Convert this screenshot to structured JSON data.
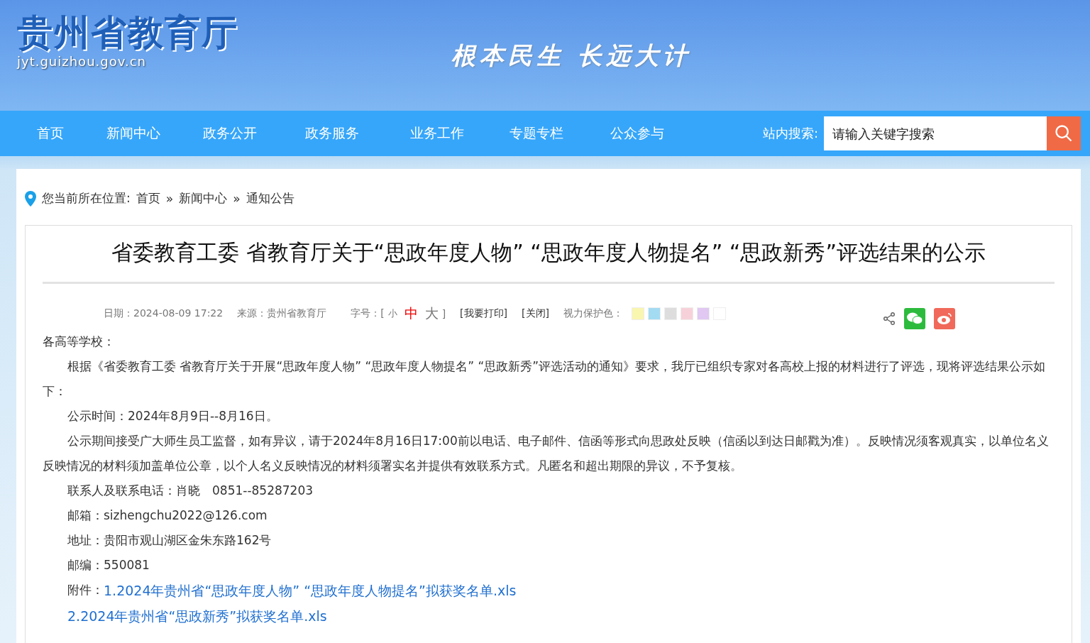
{
  "header": {
    "site_title": "贵州省教育厅",
    "site_domain": "jyt.guizhou.gov.cn",
    "slogan": "根本民生 长远大计"
  },
  "nav": {
    "items": [
      {
        "label": "首页",
        "selected": false
      },
      {
        "label": "新闻中心",
        "selected": false
      },
      {
        "label": "政务公开",
        "selected": false
      },
      {
        "label": "政务服务",
        "selected": false
      },
      {
        "label": "业务工作",
        "selected": false
      },
      {
        "label": "专题专栏",
        "selected": false
      },
      {
        "label": "公众参与",
        "selected": false
      }
    ],
    "search_label": "站内搜索:",
    "search": {
      "placeholder": "请输入关键字搜索"
    }
  },
  "breadcrumb": {
    "label": "您当前所在位置:",
    "items": [
      "首页",
      "新闻中心",
      "通知公告"
    ],
    "separator": "»"
  },
  "article": {
    "title": "省委教育工委 省教育厅关于“思政年度人物” “思政年度人物提名” “思政新秀”评选结果的公示",
    "meta": {
      "date": "日期：2024-08-09 17:22",
      "source": "来源：贵州省教育厅",
      "font_label": "字号：[",
      "font_sizes": [
        {
          "label": "小",
          "selected": false
        },
        {
          "label": "中",
          "selected": true
        },
        {
          "label": "大",
          "selected": false
        }
      ],
      "font_close": "]",
      "print": "[我要打印]",
      "close": "[关闭]",
      "color_label": "视力保护色：",
      "colors": [
        {
          "color": "#f9f6b0"
        },
        {
          "color": "#a3dbf3"
        },
        {
          "color": "#dddddd"
        },
        {
          "color": "#f7d1d9"
        },
        {
          "color": "#e0c8f2"
        },
        {
          "color": "#ffffff"
        }
      ]
    },
    "greeting": "各高等学校：",
    "paragraphs": [
      "根据《省委教育工委 省教育厅关于开展“思政年度人物” “思政年度人物提名” “思政新秀”评选活动的通知》要求，我厅已组织专家对各高校上报的材料进行了评选，现将评选结果公示如下：",
      "公示时间：2024年8月9日--8月16日。",
      "公示期间接受广大师生员工监督，如有异议，请于2024年8月16日17:00前以电话、电子邮件、信函等形式向思政处反映（信函以到达日邮戳为准）。反映情况须客观真实，以单位名义反映情况的材料须加盖单位公章，以个人名义反映情况的材料须署实名并提供有效联系方式。凡匿名和超出期限的异议，不予复核。",
      "联系人及联系电话：肖晓　0851--85287203",
      "邮箱：sizhengchu2022@126.com",
      "地址：贵阳市观山湖区金朱东路162号",
      "邮编：550081"
    ],
    "attachments_label": "附件：",
    "attachments": [
      "1.2024年贵州省“思政年度人物” “思政年度人物提名”拟获奖名单.xls",
      "2.2024年贵州省“思政新秀”拟获奖名单.xls"
    ]
  }
}
